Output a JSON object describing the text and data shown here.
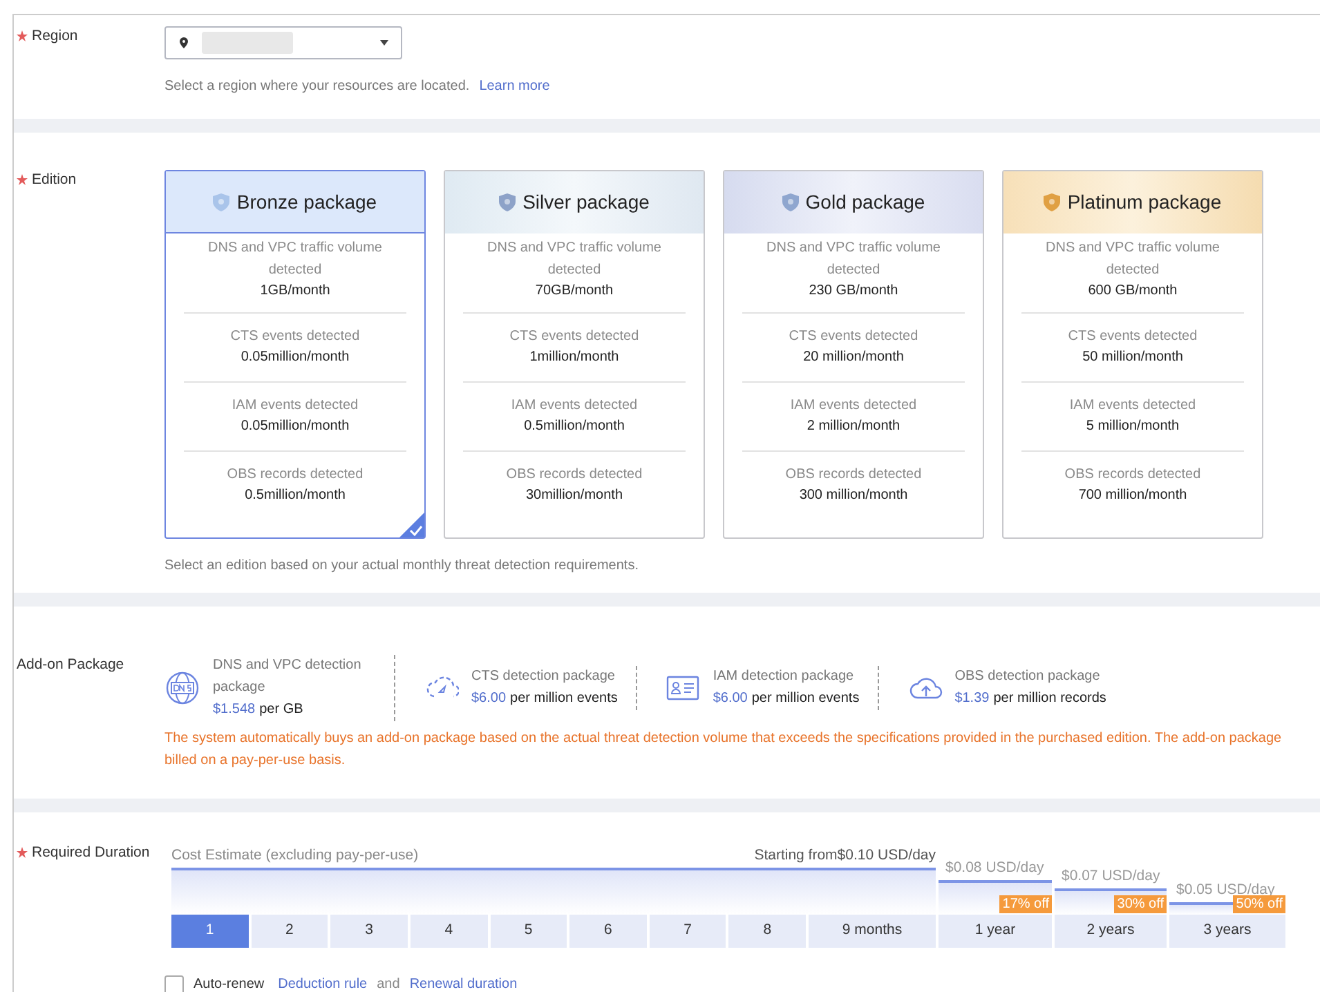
{
  "region": {
    "label": "Region",
    "required": true,
    "hint": "Select a region where your resources are located.",
    "link": "Learn more"
  },
  "edition": {
    "label": "Edition",
    "required": true,
    "cards": [
      {
        "kind": "bronze",
        "name": "Bronze package",
        "selected": true,
        "specs": [
          {
            "label": "DNS and VPC traffic volume detected",
            "value": "1GB/month"
          },
          {
            "label": "CTS events detected",
            "value": "0.05million/month"
          },
          {
            "label": "IAM events detected",
            "value": "0.05million/month"
          },
          {
            "label": "OBS records detected",
            "value": "0.5million/month"
          }
        ]
      },
      {
        "kind": "silver",
        "name": "Silver package",
        "selected": false,
        "specs": [
          {
            "label": "DNS and VPC traffic volume detected",
            "value": "70GB/month"
          },
          {
            "label": "CTS events detected",
            "value": "1million/month"
          },
          {
            "label": "IAM events detected",
            "value": "0.5million/month"
          },
          {
            "label": "OBS records detected",
            "value": "30million/month"
          }
        ]
      },
      {
        "kind": "gold",
        "name": "Gold package",
        "selected": false,
        "specs": [
          {
            "label": "DNS and VPC traffic volume detected",
            "value": "230 GB/month"
          },
          {
            "label": "CTS events detected",
            "value": "20 million/month"
          },
          {
            "label": "IAM events detected",
            "value": "2 million/month"
          },
          {
            "label": "OBS records detected",
            "value": "300 million/month"
          }
        ]
      },
      {
        "kind": "platinum",
        "name": "Platinum package",
        "selected": false,
        "specs": [
          {
            "label": "DNS and VPC traffic volume detected",
            "value": "600 GB/month"
          },
          {
            "label": "CTS events detected",
            "value": "50 million/month"
          },
          {
            "label": "IAM events detected",
            "value": "5 million/month"
          },
          {
            "label": "OBS records detected",
            "value": "700 million/month"
          }
        ]
      }
    ],
    "hint": "Select an edition based on your actual monthly threat detection requirements."
  },
  "addon": {
    "label": "Add-on Package",
    "required": false,
    "items": [
      {
        "kind": "dns",
        "title": "DNS and VPC detection package",
        "price": "$1.548",
        "unit": "per GB"
      },
      {
        "kind": "cts",
        "title": "CTS detection package",
        "price": "$6.00",
        "unit": "per million events"
      },
      {
        "kind": "iam",
        "title": "IAM detection package",
        "price": "$6.00",
        "unit": "per million events"
      },
      {
        "kind": "obs",
        "title": "OBS detection package",
        "price": "$1.39",
        "unit": "per million records"
      }
    ],
    "note_lines": [
      "The system automatically buys an add-on package based on the actual threat detection volume that exceeds the specifications provided in the purchased edition. The add-on package",
      "billed on a pay-per-use basis."
    ]
  },
  "duration": {
    "label": "Required Duration",
    "required": true,
    "estimate_label": "Cost Estimate (excluding pay-per-use)",
    "tiers": [
      {
        "price": "Starting from$0.10 USD/day",
        "options": [
          {
            "label": "1",
            "selected": true
          },
          {
            "label": "2",
            "selected": false
          },
          {
            "label": "3",
            "selected": false
          },
          {
            "label": "4",
            "selected": false
          },
          {
            "label": "5",
            "selected": false
          },
          {
            "label": "6",
            "selected": false
          },
          {
            "label": "7",
            "selected": false
          },
          {
            "label": "8",
            "selected": false
          },
          {
            "label": "9 months",
            "selected": false
          }
        ]
      },
      {
        "price": "$0.08 USD/day",
        "discount": "17% off",
        "options": [
          {
            "label": "1 year",
            "selected": false
          }
        ]
      },
      {
        "price": "$0.07 USD/day",
        "discount": "30% off",
        "options": [
          {
            "label": "2 years",
            "selected": false
          }
        ]
      },
      {
        "price": "$0.05 USD/day",
        "discount": "50% off",
        "options": [
          {
            "label": "3 years",
            "selected": false
          }
        ]
      }
    ],
    "auto_renew": {
      "label": "Auto-renew",
      "checked": false,
      "link_1": "Deduction rule",
      "joiner": "and",
      "link_2": "Renewal duration"
    }
  }
}
